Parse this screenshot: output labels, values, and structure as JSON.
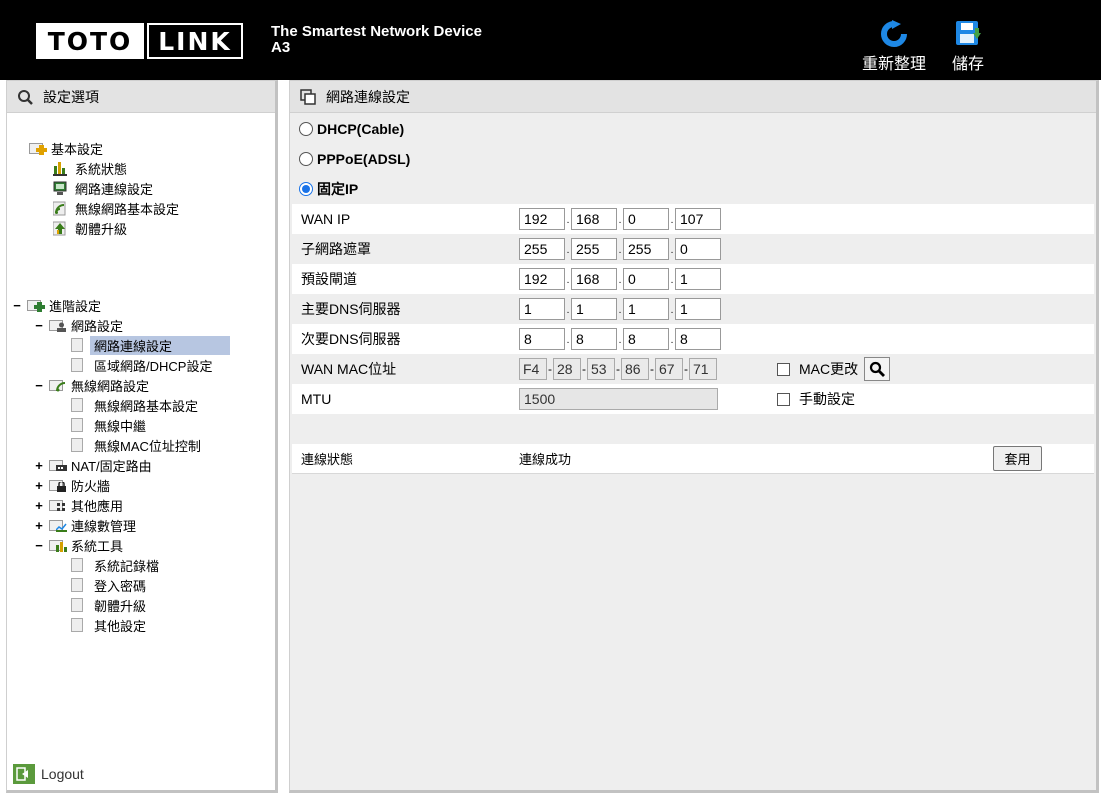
{
  "header": {
    "logo_left": "TOTO",
    "logo_right": "LINK",
    "tagline": "The Smartest Network Device",
    "model": "A3",
    "refresh_label": "重新整理",
    "save_label": "儲存",
    "colors": {
      "background": "#000000",
      "refresh_icon": "#1e88e5",
      "save_icon": "#1e88e5"
    }
  },
  "sidebar": {
    "title": "設定選項",
    "basic": {
      "label": "基本設定",
      "items": [
        "系統狀態",
        "網路連線設定",
        "無線網路基本設定",
        "韌體升級"
      ]
    },
    "advanced": {
      "toggle": "−",
      "label": "進階設定",
      "network": {
        "toggle": "−",
        "label": "網路設定",
        "items": [
          "網路連線設定",
          "區域網路/DHCP設定"
        ]
      },
      "wireless": {
        "toggle": "−",
        "label": "無線網路設定",
        "items": [
          "無線網路基本設定",
          "無線中繼",
          "無線MAC位址控制"
        ]
      },
      "nat": {
        "toggle": "+",
        "label": "NAT/固定路由"
      },
      "firewall": {
        "toggle": "+",
        "label": "防火牆"
      },
      "other": {
        "toggle": "+",
        "label": "其他應用"
      },
      "conn_mgmt": {
        "toggle": "+",
        "label": "連線數管理"
      },
      "tools": {
        "toggle": "−",
        "label": "系統工具",
        "items": [
          "系統記錄檔",
          "登入密碼",
          "韌體升級",
          "其他設定"
        ]
      }
    },
    "selected": "網路連線設定",
    "logout": "Logout"
  },
  "main": {
    "title": "網路連線設定",
    "modes": [
      {
        "label": "DHCP(Cable)",
        "checked": false
      },
      {
        "label": "PPPoE(ADSL)",
        "checked": false
      },
      {
        "label": "固定IP",
        "checked": true
      }
    ],
    "fields": {
      "wan_ip": {
        "label": "WAN IP",
        "octets": [
          "192",
          "168",
          "0",
          "107"
        ]
      },
      "subnet": {
        "label": "子網路遮罩",
        "octets": [
          "255",
          "255",
          "255",
          "0"
        ]
      },
      "gateway": {
        "label": "預設閘道",
        "octets": [
          "192",
          "168",
          "0",
          "1"
        ]
      },
      "dns1": {
        "label": "主要DNS伺服器",
        "octets": [
          "1",
          "1",
          "1",
          "1"
        ]
      },
      "dns2": {
        "label": "次要DNS伺服器",
        "octets": [
          "8",
          "8",
          "8",
          "8"
        ]
      },
      "mac": {
        "label": "WAN MAC位址",
        "parts": [
          "F4",
          "28",
          "53",
          "86",
          "67",
          "71"
        ],
        "change_label": "MAC更改"
      },
      "mtu": {
        "label": "MTU",
        "value": "1500",
        "manual_label": "手動設定"
      }
    },
    "status": {
      "label": "連線狀態",
      "value": "連線成功"
    },
    "apply_label": "套用"
  }
}
